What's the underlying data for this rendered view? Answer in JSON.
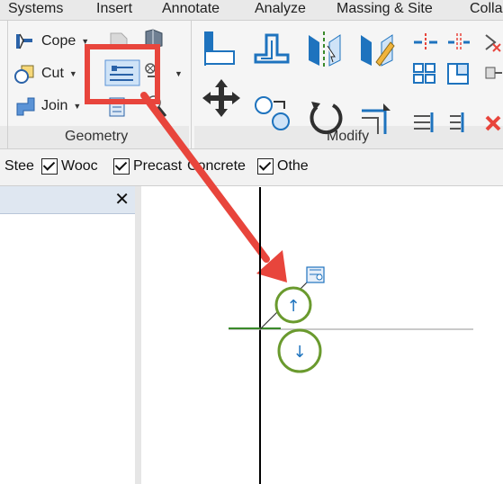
{
  "menu": [
    "Systems",
    "Insert",
    "Annotate",
    "Analyze",
    "Massing & Site",
    "Colla"
  ],
  "geometry": {
    "title": "Geometry",
    "cope_label": "Cope",
    "cut_label": "Cut",
    "join_label": "Join"
  },
  "modify": {
    "title": "Modify"
  },
  "filters": [
    {
      "label": "Stee",
      "checked": true
    },
    {
      "label": "Wooc",
      "checked": true
    },
    {
      "label": "Precast",
      "checked": true
    },
    {
      "label": "Concrete",
      "checked": true
    },
    {
      "label": "Othe",
      "checked": true
    }
  ],
  "properties_close": "✕",
  "canvas": {
    "flip_up_glyph": "↑",
    "flip_down_glyph": "↓"
  },
  "colors": {
    "highlight": "#e8453c",
    "arrow": "#e8453c",
    "flip_circle": "#6a9a2e",
    "ribbon_blue": "#1e73be",
    "wall_line": "#3a8a2a"
  },
  "icons": {
    "cope": "cope-icon",
    "cut": "cut-icon",
    "join": "join-icon",
    "highlighted": "wall-joins-icon",
    "move": "move-icon",
    "rotate": "rotate-icon",
    "delete": "delete-icon"
  }
}
